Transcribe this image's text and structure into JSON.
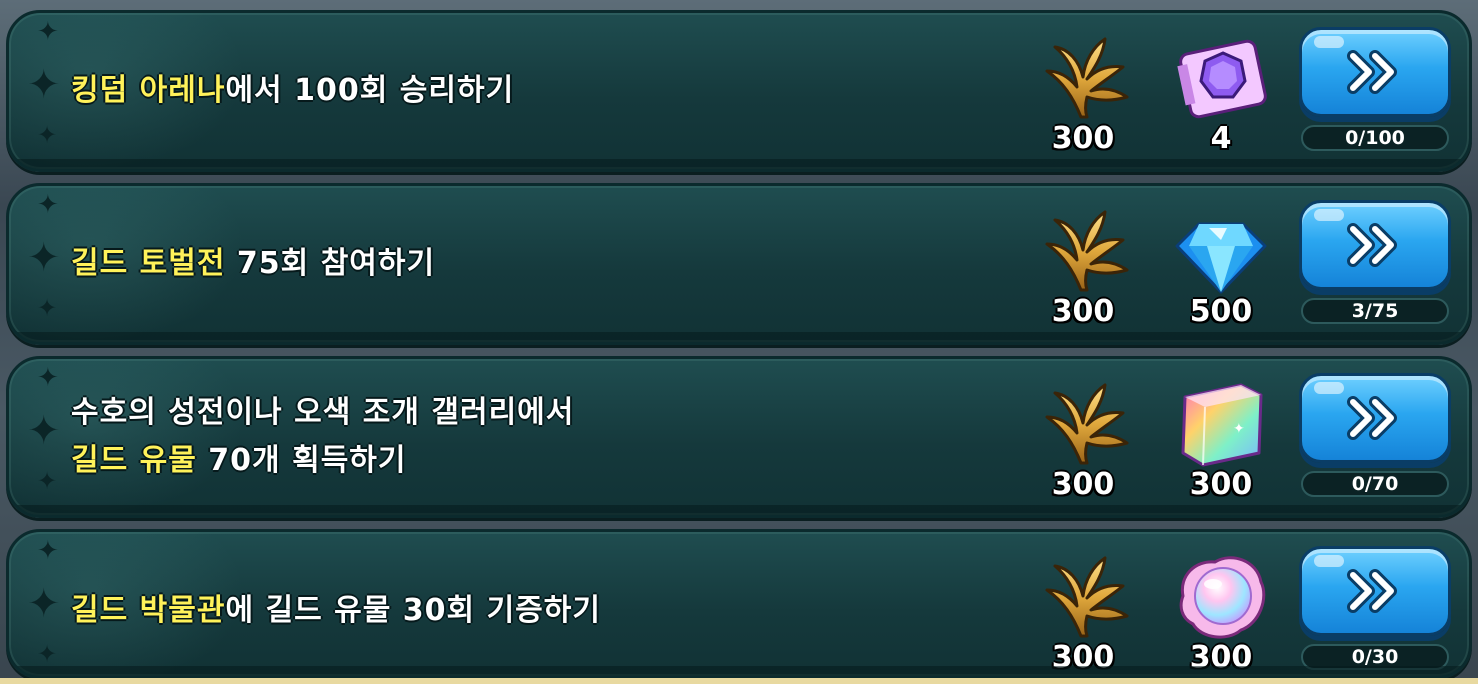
{
  "missions": [
    {
      "text_lines": [
        [
          {
            "text": "킹덤 아레나",
            "highlight": true
          },
          {
            "text": "에서 100회 승리하기",
            "highlight": false
          }
        ]
      ],
      "rewards": [
        {
          "icon": "golden-laurel-icon",
          "amount": "300"
        },
        {
          "icon": "purple-gem-ticket-icon",
          "amount": "4"
        }
      ],
      "progress": "0/100"
    },
    {
      "text_lines": [
        [
          {
            "text": "길드 토벌전",
            "highlight": true
          },
          {
            "text": " 75회 참여하기",
            "highlight": false
          }
        ]
      ],
      "rewards": [
        {
          "icon": "golden-laurel-icon",
          "amount": "300"
        },
        {
          "icon": "blue-crystal-icon",
          "amount": "500"
        }
      ],
      "progress": "3/75"
    },
    {
      "text_lines": [
        [
          {
            "text": "수호의 성전이나 오색 조개 갤러리에서",
            "highlight": false
          }
        ],
        [
          {
            "text": "길드 유물",
            "highlight": true
          },
          {
            "text": " 70개 획득하기",
            "highlight": false
          }
        ]
      ],
      "rewards": [
        {
          "icon": "golden-laurel-icon",
          "amount": "300"
        },
        {
          "icon": "rainbow-cube-icon",
          "amount": "300"
        }
      ],
      "progress": "0/70"
    },
    {
      "text_lines": [
        [
          {
            "text": "길드 박물관",
            "highlight": true
          },
          {
            "text": "에 길드 유물 30회 기증하기",
            "highlight": false
          }
        ]
      ],
      "rewards": [
        {
          "icon": "golden-laurel-icon",
          "amount": "300"
        },
        {
          "icon": "rainbow-pearl-icon",
          "amount": "300"
        }
      ],
      "progress": "0/30"
    }
  ],
  "go_button_icon": "double-chevron-right-icon",
  "colors": {
    "highlight_text": "#fff25a",
    "card_bg": "#15393c",
    "button_blue": "#2aa6f0",
    "laurel_gold": "#d9a43c"
  }
}
